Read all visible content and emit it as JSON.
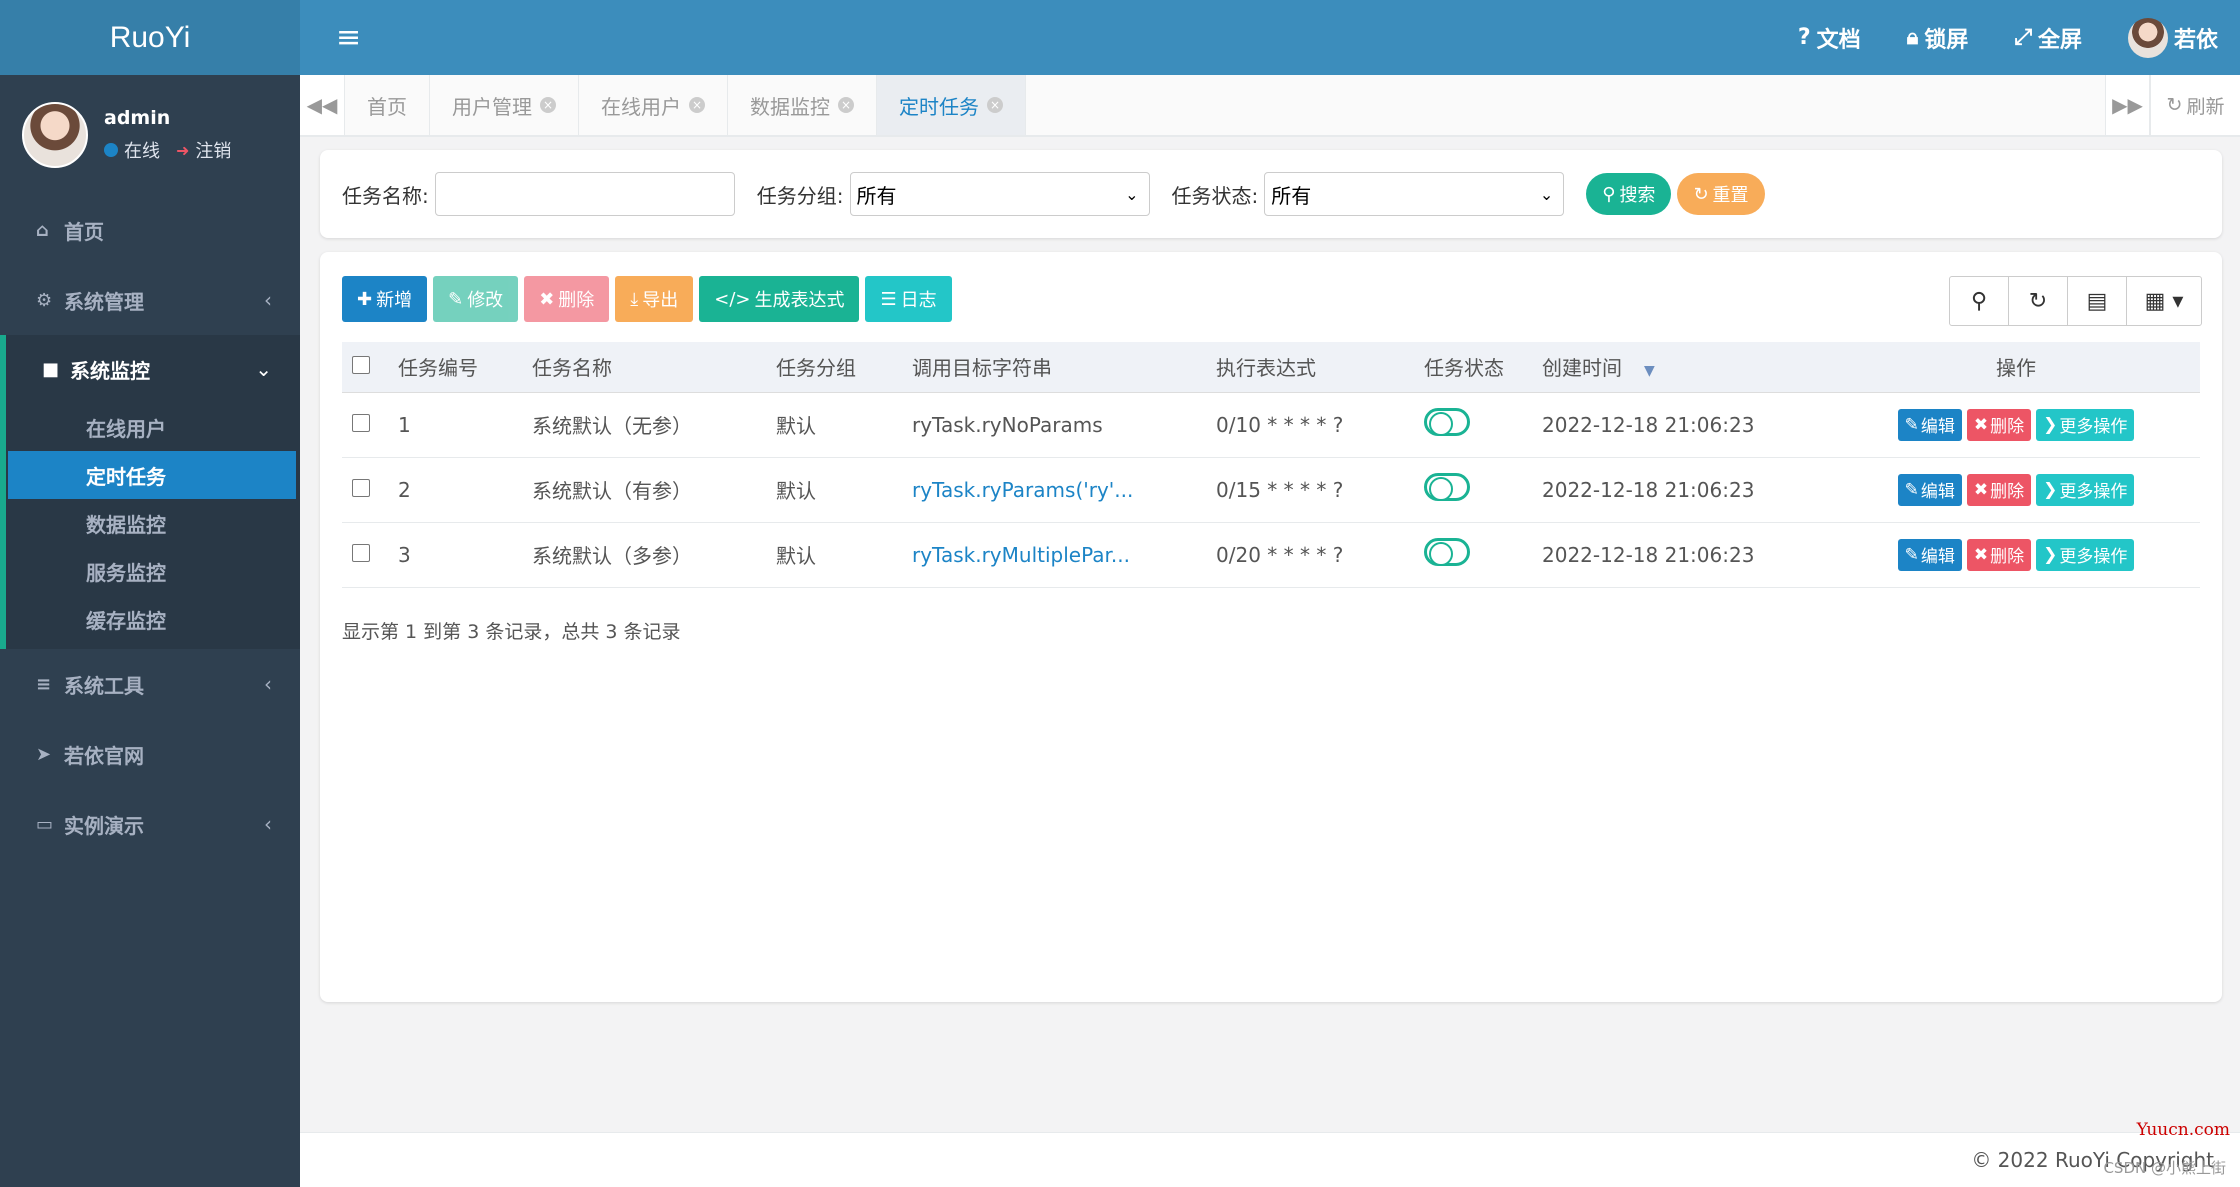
{
  "brand": "RuoYi",
  "user": {
    "name": "admin",
    "status": "在线",
    "logout": "注销"
  },
  "sidebar": {
    "items": [
      {
        "label": "首页",
        "icon": "home-icon"
      },
      {
        "label": "系统管理",
        "icon": "gear-icon"
      },
      {
        "label": "系统监控",
        "icon": "video-icon"
      },
      {
        "label": "系统工具",
        "icon": "bars-icon"
      },
      {
        "label": "若依官网",
        "icon": "send-icon"
      },
      {
        "label": "实例演示",
        "icon": "desktop-icon"
      }
    ],
    "monitor_sub": [
      "在线用户",
      "定时任务",
      "数据监控",
      "服务监控",
      "缓存监控"
    ]
  },
  "header": {
    "docs": "文档",
    "lock": "锁屏",
    "fullscreen": "全屏",
    "username": "若依"
  },
  "tabs": [
    "首页",
    "用户管理",
    "在线用户",
    "数据监控",
    "定时任务"
  ],
  "tabs_refresh": "刷新",
  "search": {
    "job_name_label": "任务名称:",
    "job_group_label": "任务分组:",
    "job_group_value": "所有",
    "job_status_label": "任务状态:",
    "job_status_value": "所有",
    "search_btn": "搜索",
    "reset_btn": "重置"
  },
  "toolbar": {
    "add": "新增",
    "edit": "修改",
    "delete": "删除",
    "export": "导出",
    "cron": "生成表达式",
    "log": "日志"
  },
  "table": {
    "headers": [
      "任务编号",
      "任务名称",
      "任务分组",
      "调用目标字符串",
      "执行表达式",
      "任务状态",
      "创建时间",
      "操作"
    ],
    "rows": [
      {
        "id": "1",
        "name": "系统默认（无参）",
        "group": "默认",
        "target": "ryTask.ryNoParams",
        "cron": "0/10 * * * * ?",
        "created": "2022-12-18 21:06:23"
      },
      {
        "id": "2",
        "name": "系统默认（有参）",
        "group": "默认",
        "target": "ryTask.ryParams('ry'...",
        "cron": "0/15 * * * * ?",
        "created": "2022-12-18 21:06:23"
      },
      {
        "id": "3",
        "name": "系统默认（多参）",
        "group": "默认",
        "target": "ryTask.ryMultiplePar...",
        "cron": "0/20 * * * * ?",
        "created": "2022-12-18 21:06:23"
      }
    ],
    "row_actions": {
      "edit": "编辑",
      "delete": "删除",
      "more": "更多操作"
    }
  },
  "pager": "显示第 1 到第 3 条记录，总共 3 条记录",
  "footer": "© 2022 RuoYi Copyright",
  "watermark": "Yuucn.com",
  "watermark2": "CSDN @小熊上街",
  "colors": {
    "sidebar": "#2f4050",
    "header": "#3c8dbc",
    "primary": "#1c84c6",
    "success": "#1ab394",
    "danger": "#ed5565",
    "warning": "#f8ac59",
    "info": "#23c6c8"
  }
}
